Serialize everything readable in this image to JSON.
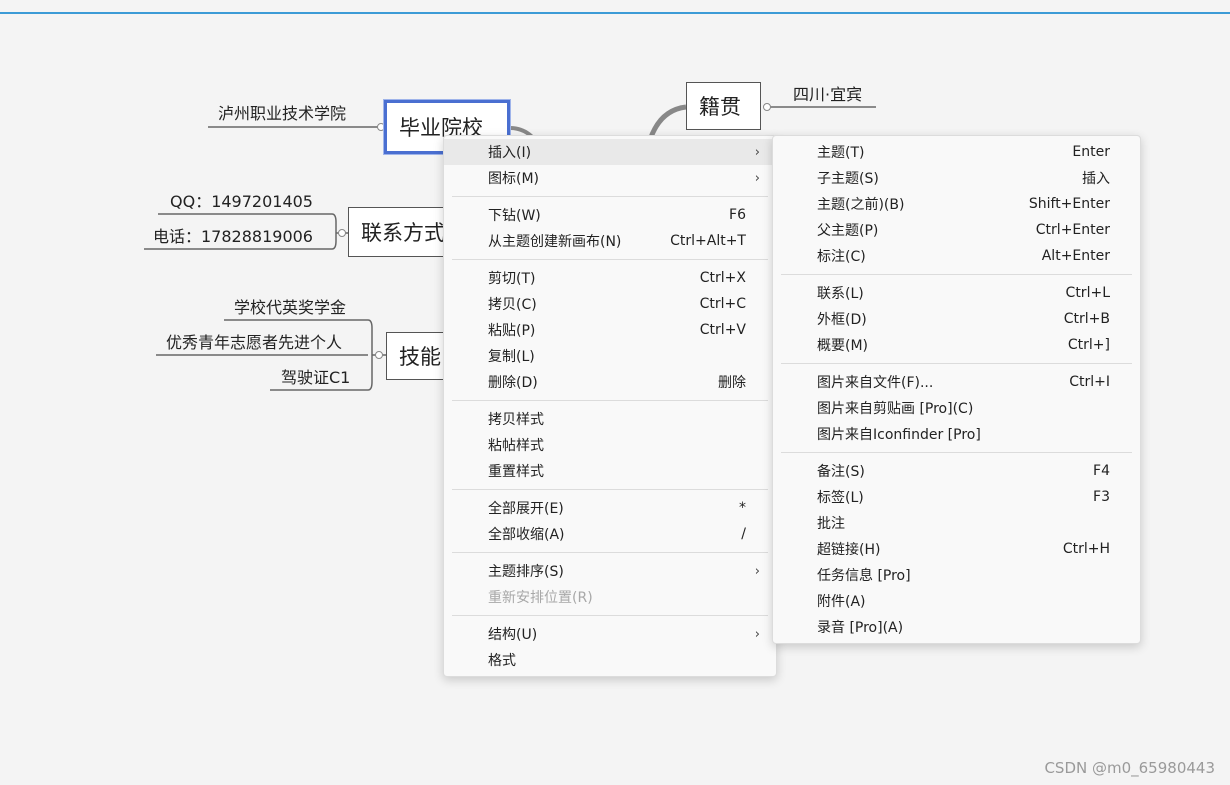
{
  "mindmap": {
    "topics": {
      "school": "毕业院校",
      "contact": "联系方式",
      "skills": "技能",
      "hometown": "籍贯"
    },
    "subtopics": {
      "school_name": "泸州职业技术学院",
      "qq": "QQ：1497201405",
      "phone": "电话：17828819006",
      "award": "学校代英奖学金",
      "volunteer": "优秀青年志愿者先进个人",
      "license": "驾驶证C1",
      "hometown_value": "四川·宜宾"
    }
  },
  "context_menu": {
    "groups": [
      [
        {
          "label": "插入(I)",
          "shortcut": "",
          "submenu": true,
          "highlighted": true
        },
        {
          "label": "图标(M)",
          "shortcut": "",
          "submenu": true
        }
      ],
      [
        {
          "label": "下钻(W)",
          "shortcut": "F6"
        },
        {
          "label": "从主题创建新画布(N)",
          "shortcut": "Ctrl+Alt+T"
        }
      ],
      [
        {
          "label": "剪切(T)",
          "shortcut": "Ctrl+X"
        },
        {
          "label": "拷贝(C)",
          "shortcut": "Ctrl+C"
        },
        {
          "label": "粘贴(P)",
          "shortcut": "Ctrl+V"
        },
        {
          "label": "复制(L)",
          "shortcut": ""
        },
        {
          "label": "删除(D)",
          "shortcut": "删除"
        }
      ],
      [
        {
          "label": "拷贝样式",
          "shortcut": ""
        },
        {
          "label": "粘帖样式",
          "shortcut": ""
        },
        {
          "label": "重置样式",
          "shortcut": ""
        }
      ],
      [
        {
          "label": "全部展开(E)",
          "shortcut": "*"
        },
        {
          "label": "全部收缩(A)",
          "shortcut": "/"
        }
      ],
      [
        {
          "label": "主题排序(S)",
          "shortcut": "",
          "submenu": true
        },
        {
          "label": "重新安排位置(R)",
          "shortcut": "",
          "disabled": true
        }
      ],
      [
        {
          "label": "结构(U)",
          "shortcut": "",
          "submenu": true
        },
        {
          "label": "格式",
          "shortcut": ""
        }
      ]
    ]
  },
  "submenu_insert": {
    "groups": [
      [
        {
          "label": "主题(T)",
          "shortcut": "Enter"
        },
        {
          "label": "子主题(S)",
          "shortcut": "插入"
        },
        {
          "label": "主题(之前)(B)",
          "shortcut": "Shift+Enter"
        },
        {
          "label": "父主题(P)",
          "shortcut": "Ctrl+Enter"
        },
        {
          "label": "标注(C)",
          "shortcut": "Alt+Enter"
        }
      ],
      [
        {
          "label": "联系(L)",
          "shortcut": "Ctrl+L"
        },
        {
          "label": "外框(D)",
          "shortcut": "Ctrl+B"
        },
        {
          "label": "概要(M)",
          "shortcut": "Ctrl+]"
        }
      ],
      [
        {
          "label": "图片来自文件(F)...",
          "shortcut": "Ctrl+I"
        },
        {
          "label": "图片来自剪贴画 [Pro](C)",
          "shortcut": ""
        },
        {
          "label": "图片来自Iconfinder [Pro]",
          "shortcut": ""
        }
      ],
      [
        {
          "label": "备注(S)",
          "shortcut": "F4"
        },
        {
          "label": "标签(L)",
          "shortcut": "F3"
        },
        {
          "label": "批注",
          "shortcut": ""
        },
        {
          "label": "超链接(H)",
          "shortcut": "Ctrl+H"
        },
        {
          "label": "任务信息 [Pro]",
          "shortcut": ""
        },
        {
          "label": "附件(A)",
          "shortcut": ""
        },
        {
          "label": "录音 [Pro](A)",
          "shortcut": ""
        }
      ]
    ]
  },
  "watermark": "CSDN @m0_65980443",
  "colors": {
    "selection": "#4a6fd1",
    "accent_line": "#3c9bd6"
  }
}
